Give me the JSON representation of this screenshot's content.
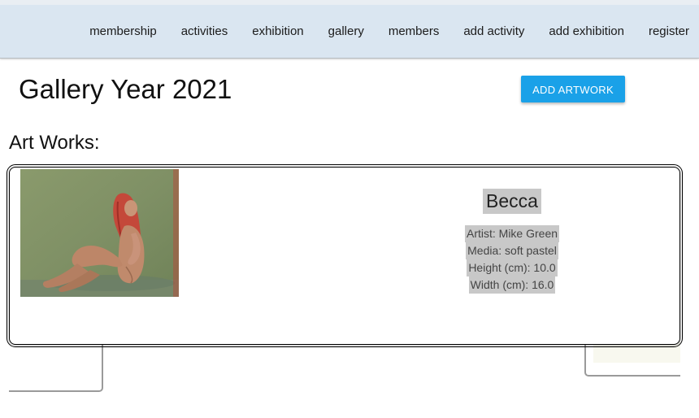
{
  "nav": {
    "items": [
      {
        "label": "membership"
      },
      {
        "label": "activities"
      },
      {
        "label": "exhibition"
      },
      {
        "label": "gallery"
      },
      {
        "label": "members"
      },
      {
        "label": "add activity"
      },
      {
        "label": "add exhibition"
      },
      {
        "label": "register"
      }
    ]
  },
  "header": {
    "title": "Gallery Year 2021",
    "add_button_label": "ADD ARTWORK"
  },
  "section": {
    "label": "Art Works:"
  },
  "artworks": [
    {
      "title": "Becca",
      "artist_line": "Artist: Mike Green",
      "media_line": "Media: soft pastel",
      "height_line": "Height (cm): 10.0",
      "width_line": "Width (cm): 16.0"
    }
  ],
  "colors": {
    "nav_bg": "#dae6f1",
    "accent": "#1aa1e8",
    "highlight": "#c8c8c8"
  }
}
